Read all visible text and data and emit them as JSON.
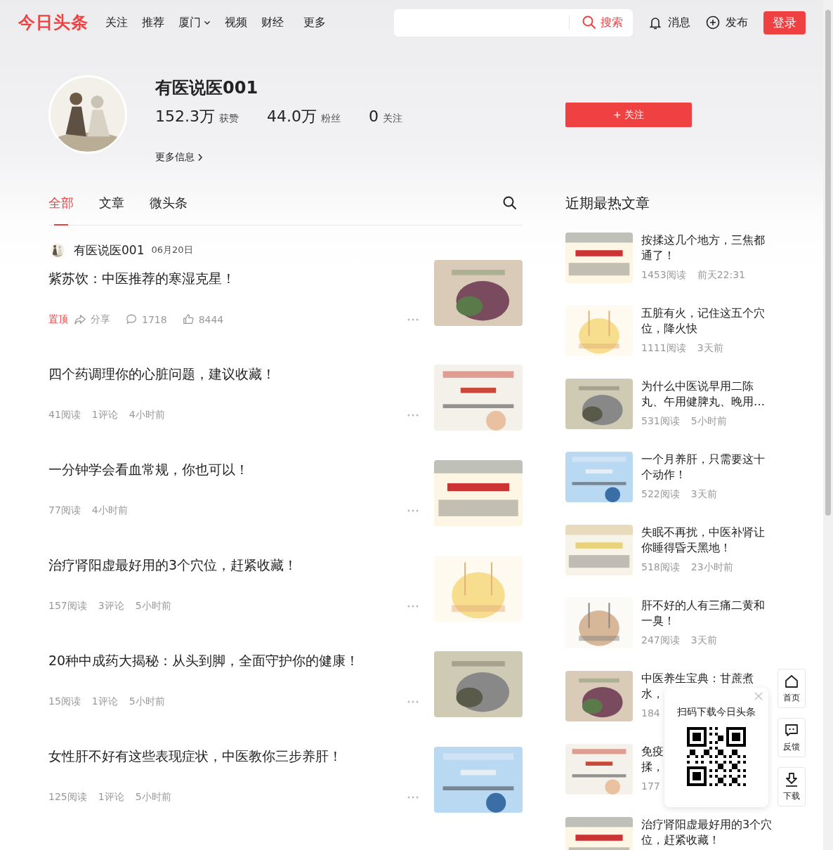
{
  "header": {
    "logo": "今日头条",
    "nav": [
      {
        "label": "关注",
        "dropdown": false
      },
      {
        "label": "推荐",
        "dropdown": false
      },
      {
        "label": "厦门",
        "dropdown": true
      },
      {
        "label": "视频",
        "dropdown": false
      },
      {
        "label": "财经",
        "dropdown": false
      },
      {
        "label": "更多",
        "dropdown": false
      }
    ],
    "search_button": "搜索",
    "messages": "消息",
    "publish": "发布",
    "login": "登录"
  },
  "profile": {
    "name": "有医说医001",
    "stats": [
      {
        "value": "152.3万",
        "label": "获赞"
      },
      {
        "value": "44.0万",
        "label": "粉丝"
      },
      {
        "value": "0",
        "label": "关注"
      }
    ],
    "follow_button": "+ 关注",
    "more_info": "更多信息"
  },
  "tabs": [
    {
      "label": "全部",
      "selected": true
    },
    {
      "label": "文章",
      "selected": false
    },
    {
      "label": "微头条",
      "selected": false
    }
  ],
  "feed_author": {
    "name": "有医说医001",
    "date": "06月20日"
  },
  "articles": [
    {
      "title": "紫苏饮：中医推荐的寒湿克星！",
      "kind": "pinned",
      "pin": "置顶",
      "share": "分享",
      "comments": "1718",
      "likes": "8444"
    },
    {
      "title": "四个药调理你的心脏问题，建议收藏！",
      "kind": "stats",
      "stats": [
        "41阅读",
        "1评论",
        "4小时前"
      ]
    },
    {
      "title": "一分钟学会看血常规，你也可以！",
      "kind": "stats",
      "stats": [
        "77阅读",
        "4小时前"
      ]
    },
    {
      "title": "治疗肾阳虚最好用的3个穴位，赶紧收藏！",
      "kind": "stats",
      "stats": [
        "157阅读",
        "3评论",
        "5小时前"
      ]
    },
    {
      "title": "20种中成药大揭秘：从头到脚，全面守护你的健康！",
      "kind": "stats",
      "stats": [
        "15阅读",
        "1评论",
        "5小时前"
      ]
    },
    {
      "title": "女性肝不好有这些表现症状，中医教你三步养肝！",
      "kind": "stats",
      "stats": [
        "125阅读",
        "1评论",
        "5小时前"
      ]
    }
  ],
  "hot": {
    "title": "近期最热文章",
    "items": [
      {
        "title": "按揉这几个地方，三焦都通了！",
        "reads": "1453阅读",
        "time": "前天22:31"
      },
      {
        "title": "五脏有火，记住这五个穴位，降火快",
        "reads": "1111阅读",
        "time": "3天前"
      },
      {
        "title": "为什么中医说早用二陈丸、午用健脾丸、晚用…",
        "reads": "531阅读",
        "time": "5小时前"
      },
      {
        "title": "一个月养肝，只需要这十个动作！",
        "reads": "522阅读",
        "time": "3天前"
      },
      {
        "title": "失眠不再扰，中医补肾让你睡得昏天黑地！",
        "reads": "518阅读",
        "time": "23小时前"
      },
      {
        "title": "肝不好的人有三痛二黄和一臭！",
        "reads": "247阅读",
        "time": "3天前"
      },
      {
        "title_lines": [
          "中医养生宝典：甘蔗煮",
          "水，"
        ],
        "reads": "184"
      },
      {
        "title_lines": [
          "免疫",
          "揉，"
        ],
        "reads": "177"
      },
      {
        "title": "治疗肾阳虚最好用的3个穴位，赶紧收藏！"
      }
    ]
  },
  "qr_popup": {
    "title": "扫码下载今日头条"
  },
  "side_buttons": [
    {
      "label": "首页",
      "kind": "home"
    },
    {
      "label": "反馈",
      "kind": "feedback"
    },
    {
      "label": "下载",
      "kind": "download"
    }
  ]
}
